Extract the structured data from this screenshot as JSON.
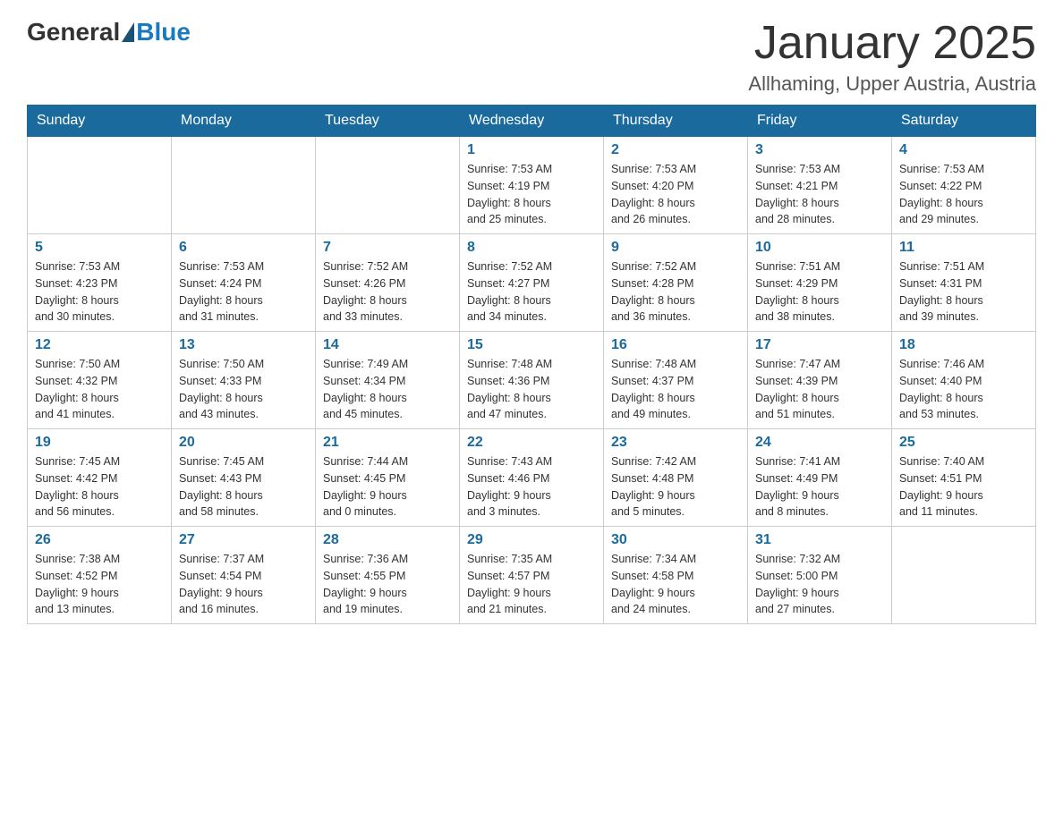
{
  "header": {
    "logo_general": "General",
    "logo_blue": "Blue",
    "month_title": "January 2025",
    "location": "Allhaming, Upper Austria, Austria"
  },
  "days_of_week": [
    "Sunday",
    "Monday",
    "Tuesday",
    "Wednesday",
    "Thursday",
    "Friday",
    "Saturday"
  ],
  "weeks": [
    [
      {
        "day": "",
        "info": ""
      },
      {
        "day": "",
        "info": ""
      },
      {
        "day": "",
        "info": ""
      },
      {
        "day": "1",
        "info": "Sunrise: 7:53 AM\nSunset: 4:19 PM\nDaylight: 8 hours\nand 25 minutes."
      },
      {
        "day": "2",
        "info": "Sunrise: 7:53 AM\nSunset: 4:20 PM\nDaylight: 8 hours\nand 26 minutes."
      },
      {
        "day": "3",
        "info": "Sunrise: 7:53 AM\nSunset: 4:21 PM\nDaylight: 8 hours\nand 28 minutes."
      },
      {
        "day": "4",
        "info": "Sunrise: 7:53 AM\nSunset: 4:22 PM\nDaylight: 8 hours\nand 29 minutes."
      }
    ],
    [
      {
        "day": "5",
        "info": "Sunrise: 7:53 AM\nSunset: 4:23 PM\nDaylight: 8 hours\nand 30 minutes."
      },
      {
        "day": "6",
        "info": "Sunrise: 7:53 AM\nSunset: 4:24 PM\nDaylight: 8 hours\nand 31 minutes."
      },
      {
        "day": "7",
        "info": "Sunrise: 7:52 AM\nSunset: 4:26 PM\nDaylight: 8 hours\nand 33 minutes."
      },
      {
        "day": "8",
        "info": "Sunrise: 7:52 AM\nSunset: 4:27 PM\nDaylight: 8 hours\nand 34 minutes."
      },
      {
        "day": "9",
        "info": "Sunrise: 7:52 AM\nSunset: 4:28 PM\nDaylight: 8 hours\nand 36 minutes."
      },
      {
        "day": "10",
        "info": "Sunrise: 7:51 AM\nSunset: 4:29 PM\nDaylight: 8 hours\nand 38 minutes."
      },
      {
        "day": "11",
        "info": "Sunrise: 7:51 AM\nSunset: 4:31 PM\nDaylight: 8 hours\nand 39 minutes."
      }
    ],
    [
      {
        "day": "12",
        "info": "Sunrise: 7:50 AM\nSunset: 4:32 PM\nDaylight: 8 hours\nand 41 minutes."
      },
      {
        "day": "13",
        "info": "Sunrise: 7:50 AM\nSunset: 4:33 PM\nDaylight: 8 hours\nand 43 minutes."
      },
      {
        "day": "14",
        "info": "Sunrise: 7:49 AM\nSunset: 4:34 PM\nDaylight: 8 hours\nand 45 minutes."
      },
      {
        "day": "15",
        "info": "Sunrise: 7:48 AM\nSunset: 4:36 PM\nDaylight: 8 hours\nand 47 minutes."
      },
      {
        "day": "16",
        "info": "Sunrise: 7:48 AM\nSunset: 4:37 PM\nDaylight: 8 hours\nand 49 minutes."
      },
      {
        "day": "17",
        "info": "Sunrise: 7:47 AM\nSunset: 4:39 PM\nDaylight: 8 hours\nand 51 minutes."
      },
      {
        "day": "18",
        "info": "Sunrise: 7:46 AM\nSunset: 4:40 PM\nDaylight: 8 hours\nand 53 minutes."
      }
    ],
    [
      {
        "day": "19",
        "info": "Sunrise: 7:45 AM\nSunset: 4:42 PM\nDaylight: 8 hours\nand 56 minutes."
      },
      {
        "day": "20",
        "info": "Sunrise: 7:45 AM\nSunset: 4:43 PM\nDaylight: 8 hours\nand 58 minutes."
      },
      {
        "day": "21",
        "info": "Sunrise: 7:44 AM\nSunset: 4:45 PM\nDaylight: 9 hours\nand 0 minutes."
      },
      {
        "day": "22",
        "info": "Sunrise: 7:43 AM\nSunset: 4:46 PM\nDaylight: 9 hours\nand 3 minutes."
      },
      {
        "day": "23",
        "info": "Sunrise: 7:42 AM\nSunset: 4:48 PM\nDaylight: 9 hours\nand 5 minutes."
      },
      {
        "day": "24",
        "info": "Sunrise: 7:41 AM\nSunset: 4:49 PM\nDaylight: 9 hours\nand 8 minutes."
      },
      {
        "day": "25",
        "info": "Sunrise: 7:40 AM\nSunset: 4:51 PM\nDaylight: 9 hours\nand 11 minutes."
      }
    ],
    [
      {
        "day": "26",
        "info": "Sunrise: 7:38 AM\nSunset: 4:52 PM\nDaylight: 9 hours\nand 13 minutes."
      },
      {
        "day": "27",
        "info": "Sunrise: 7:37 AM\nSunset: 4:54 PM\nDaylight: 9 hours\nand 16 minutes."
      },
      {
        "day": "28",
        "info": "Sunrise: 7:36 AM\nSunset: 4:55 PM\nDaylight: 9 hours\nand 19 minutes."
      },
      {
        "day": "29",
        "info": "Sunrise: 7:35 AM\nSunset: 4:57 PM\nDaylight: 9 hours\nand 21 minutes."
      },
      {
        "day": "30",
        "info": "Sunrise: 7:34 AM\nSunset: 4:58 PM\nDaylight: 9 hours\nand 24 minutes."
      },
      {
        "day": "31",
        "info": "Sunrise: 7:32 AM\nSunset: 5:00 PM\nDaylight: 9 hours\nand 27 minutes."
      },
      {
        "day": "",
        "info": ""
      }
    ]
  ]
}
